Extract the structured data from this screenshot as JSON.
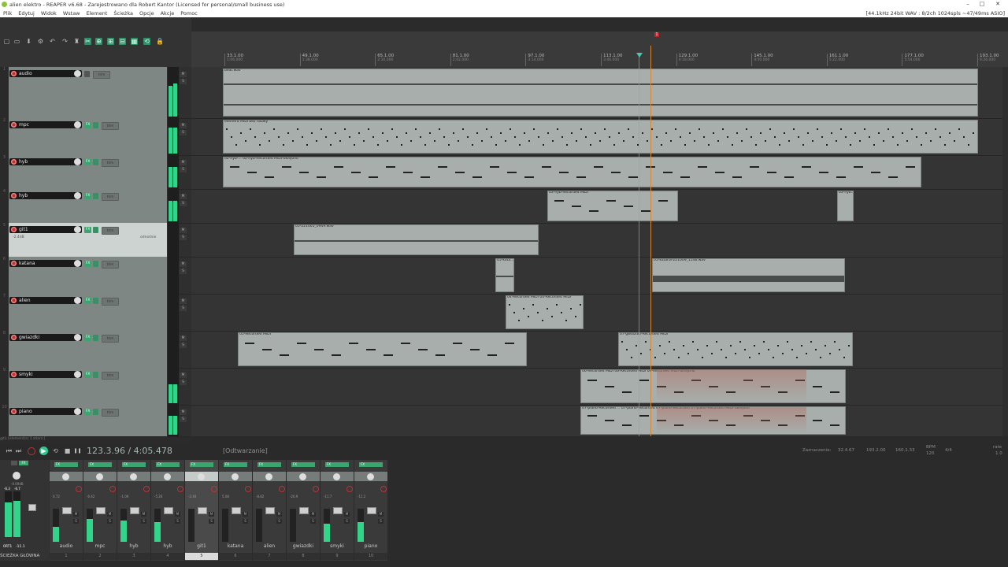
{
  "window": {
    "title": "alien elektro - REAPER v6.68 - Zarejestrowano dla Robert Kantor (Licensed for personal/small business use)",
    "status_right": "[44.1kHz 24bit WAV : 8/2ch 1024spls ~47/49ms ASIO]",
    "controls": {
      "minimize": "–",
      "maximize": "□",
      "close": "✕"
    }
  },
  "menu": [
    "Plik",
    "Edytuj",
    "Widok",
    "Wstaw",
    "Element",
    "Ścieżka",
    "Opcje",
    "Akcje",
    "Pomoc"
  ],
  "toolbar": {
    "icons": [
      "new-project-icon",
      "open-icon",
      "save-icon",
      "settings-icon",
      "undo-icon",
      "redo-icon",
      "metronome-icon",
      "snap-icon",
      "link-icon",
      "grid-icon",
      "ripple-icon",
      "grid2-icon",
      "loop-icon",
      "lock-icon"
    ],
    "glyphs": [
      "▢",
      "▭",
      "⬇",
      "⚙",
      "↶",
      "↷",
      "♜",
      "✂",
      "⊕",
      "⊞",
      "⊟",
      "▦",
      "⟲",
      "🔒"
    ]
  },
  "marker": {
    "label": "1"
  },
  "ruler": [
    {
      "bar": "33.1.00",
      "time": "1:06.000"
    },
    {
      "bar": "49.1.00",
      "time": "1:38.000"
    },
    {
      "bar": "65.1.00",
      "time": "2:10.000"
    },
    {
      "bar": "81.1.00",
      "time": "2:42.000"
    },
    {
      "bar": "97.1.00",
      "time": "3:14.000"
    },
    {
      "bar": "113.1.00",
      "time": "3:46.000"
    },
    {
      "bar": "129.1.00",
      "time": "4:18.000"
    },
    {
      "bar": "145.1.00",
      "time": "4:50.000"
    },
    {
      "bar": "161.1.00",
      "time": "5:22.000"
    },
    {
      "bar": "177.1.00",
      "time": "5:54.000"
    },
    {
      "bar": "193.1.00",
      "time": "6:26.000"
    }
  ],
  "track_controls": {
    "fx": "FX",
    "trim": "trim",
    "mute": "M",
    "solo": "S"
  },
  "tracks": [
    {
      "num": "1",
      "name": "audio",
      "sub": "",
      "selected": false,
      "meter": [
        0.6,
        0.65
      ]
    },
    {
      "num": "2",
      "name": "mpc",
      "sub": "",
      "selected": false,
      "meter": [
        0.7,
        0.7
      ]
    },
    {
      "num": "3",
      "name": "hyb",
      "sub": "",
      "selected": false,
      "meter": [
        0.6,
        0.6
      ]
    },
    {
      "num": "4",
      "name": "hyb",
      "sub": "",
      "selected": false,
      "meter": [
        0.6,
        0.6
      ]
    },
    {
      "num": "5",
      "name": "git1",
      "sub": "-2.4dB",
      "sub2": "odnośnie",
      "selected": true,
      "meter": [
        0,
        0
      ]
    },
    {
      "num": "6",
      "name": "katana",
      "sub": "",
      "selected": false,
      "meter": [
        0,
        0
      ]
    },
    {
      "num": "7",
      "name": "alien",
      "sub": "",
      "selected": false,
      "meter": [
        0,
        0
      ]
    },
    {
      "num": "8",
      "name": "gwiazdki",
      "sub": "",
      "selected": false,
      "meter": [
        0,
        0
      ]
    },
    {
      "num": "9",
      "name": "smyki",
      "sub": "",
      "selected": false,
      "meter": [
        0.5,
        0.5
      ]
    },
    {
      "num": "10",
      "name": "piano",
      "sub": "",
      "selected": false,
      "meter": [
        0.6,
        0.6
      ]
    }
  ],
  "items": {
    "audio_1": "beat.wav",
    "mpc_1": "element MIDI bez nazwy",
    "hyb_1": "02-hyb-... 02-hyb-Recorded MIDI-oklejono",
    "hyb_2": "02-hyb-Recorded MIDI-oklejono",
    "hyb_3": "02-hyb-Recorded MIDI 02-hyb-Recorded M...",
    "hyb4_1": "03-hyb-Recorded MIDI",
    "hyb4_2": "03-hyb...",
    "git_1": "05-221005_0949.wav",
    "katana_1": "05-kata...",
    "katana_2": "05-katana-221009_1148.wav",
    "alien_1": "04-Recorded MIDI 04-Recorded MIDI",
    "gwiazdki_1": "05-Recorded MIDI",
    "gwiazdki_2": "07-gwiazdki-Recorded MIDI",
    "smyki_1": "06-Recorded MIDI 06-Recorded MIDI 06-Recorded MIDI-oklejono",
    "piano_1": "07-piano-Recorded ... 07-piano-Recorded 07-piano-Recorded 07-piano-Recorded MIDI-oklejono"
  },
  "statusline": "git1 [element(s) 1 zdarz.]",
  "transport": {
    "time": "123.3.96 / 4:05.478",
    "state": "[Odtwarzanie]",
    "selection_label": "Zaznaczenie:",
    "sel_start": "32.4.67",
    "sel_end": "193.2.00",
    "sel_len": "160.1.33",
    "bpm_label": "BPM",
    "bpm": "120",
    "sig": "4/4",
    "rate_label": "rate",
    "rate": "1.0",
    "glyphs": {
      "to_start": "⏮",
      "to_end": "⏭",
      "play": "▶",
      "loop": "⟲",
      "stop": "■",
      "pause": "❚❚"
    }
  },
  "master": {
    "label": "ŚCIEŻKA GŁÓWNA",
    "db": "-0.09dB",
    "peaks": [
      "-6.3",
      "-6.7"
    ],
    "foot": [
      "0RT1",
      "-11.1"
    ],
    "meter": [
      0.75,
      0.8
    ]
  },
  "mixer": [
    {
      "name": "audio",
      "idx": "1",
      "db": "0.72",
      "selected": false,
      "meter": 0.45
    },
    {
      "name": "mpc",
      "idx": "2",
      "db": "-6.42",
      "selected": false,
      "meter": 0.7
    },
    {
      "name": "hyb",
      "idx": "3",
      "db": "-1.09",
      "selected": false,
      "meter": 0.65
    },
    {
      "name": "hyb",
      "idx": "4",
      "db": "-5.26",
      "selected": false,
      "meter": 0.6
    },
    {
      "name": "git1",
      "idx": "5",
      "db": "-2.40",
      "selected": true,
      "meter": 0
    },
    {
      "name": "katana",
      "idx": "6",
      "db": "5.08",
      "selected": false,
      "meter": 0
    },
    {
      "name": "alien",
      "idx": "7",
      "db": "-8.82",
      "selected": false,
      "meter": 0
    },
    {
      "name": "gwiazdki",
      "idx": "8",
      "db": "-20.9",
      "selected": false,
      "meter": 0
    },
    {
      "name": "smyki",
      "idx": "9",
      "db": "-11.7",
      "selected": false,
      "meter": 0.55
    },
    {
      "name": "piano",
      "idx": "10",
      "db": "-11.2",
      "selected": false,
      "meter": 0.6
    }
  ],
  "mixer_fx_label": "FX"
}
